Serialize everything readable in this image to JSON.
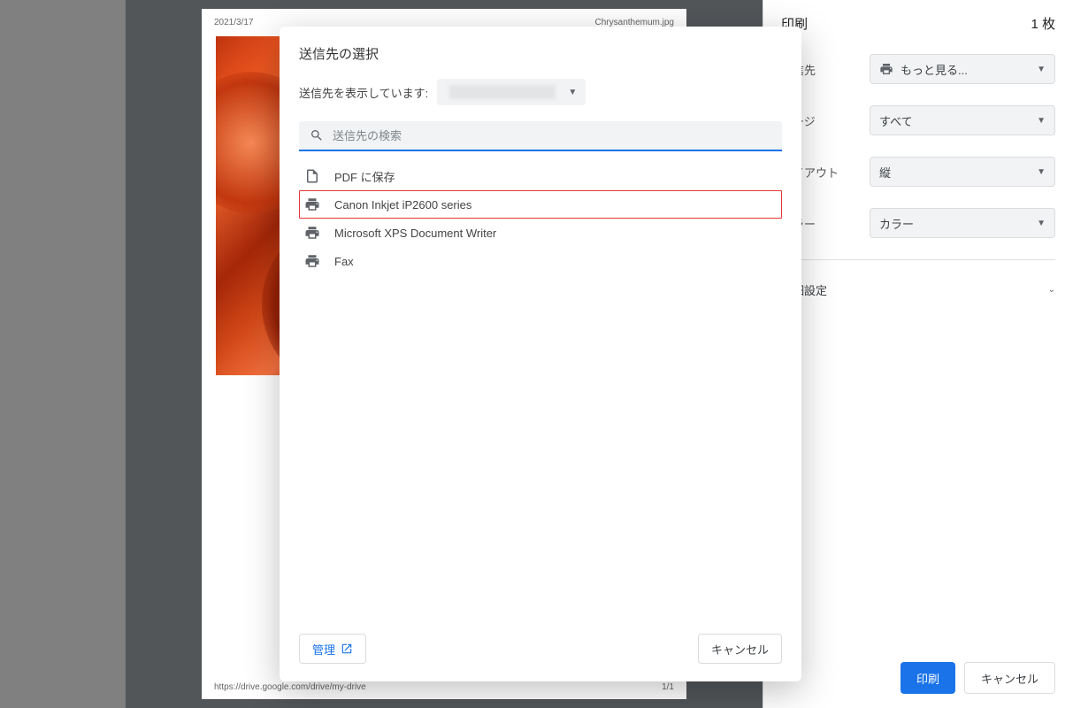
{
  "preview": {
    "date": "2021/3/17",
    "filename": "Chrysanthemum.jpg",
    "footer_url": "https://drive.google.com/drive/my-drive",
    "page_indicator": "1/1"
  },
  "options": {
    "title": "印刷",
    "sheet_count": "1 枚",
    "rows": {
      "destination_label": "送信先",
      "destination_value": "もっと見る...",
      "pages_label": "ページ",
      "pages_value": "すべて",
      "layout_label": "レイアウト",
      "layout_value": "縦",
      "color_label": "カラー",
      "color_value": "カラー"
    },
    "more_settings": "詳細設定",
    "print_btn": "印刷",
    "cancel_btn": "キャンセル"
  },
  "modal": {
    "title": "送信先の選択",
    "showing_label": "送信先を表示しています:",
    "search_placeholder": "送信先の検索",
    "destinations": [
      {
        "icon": "file-icon",
        "label": "PDF に保存",
        "highlight": false
      },
      {
        "icon": "printer-icon",
        "label": "Canon Inkjet iP2600 series",
        "highlight": true
      },
      {
        "icon": "printer-icon",
        "label": "Microsoft XPS Document Writer",
        "highlight": false
      },
      {
        "icon": "printer-icon",
        "label": "Fax",
        "highlight": false
      }
    ],
    "manage_btn": "管理",
    "cancel_btn": "キャンセル"
  }
}
